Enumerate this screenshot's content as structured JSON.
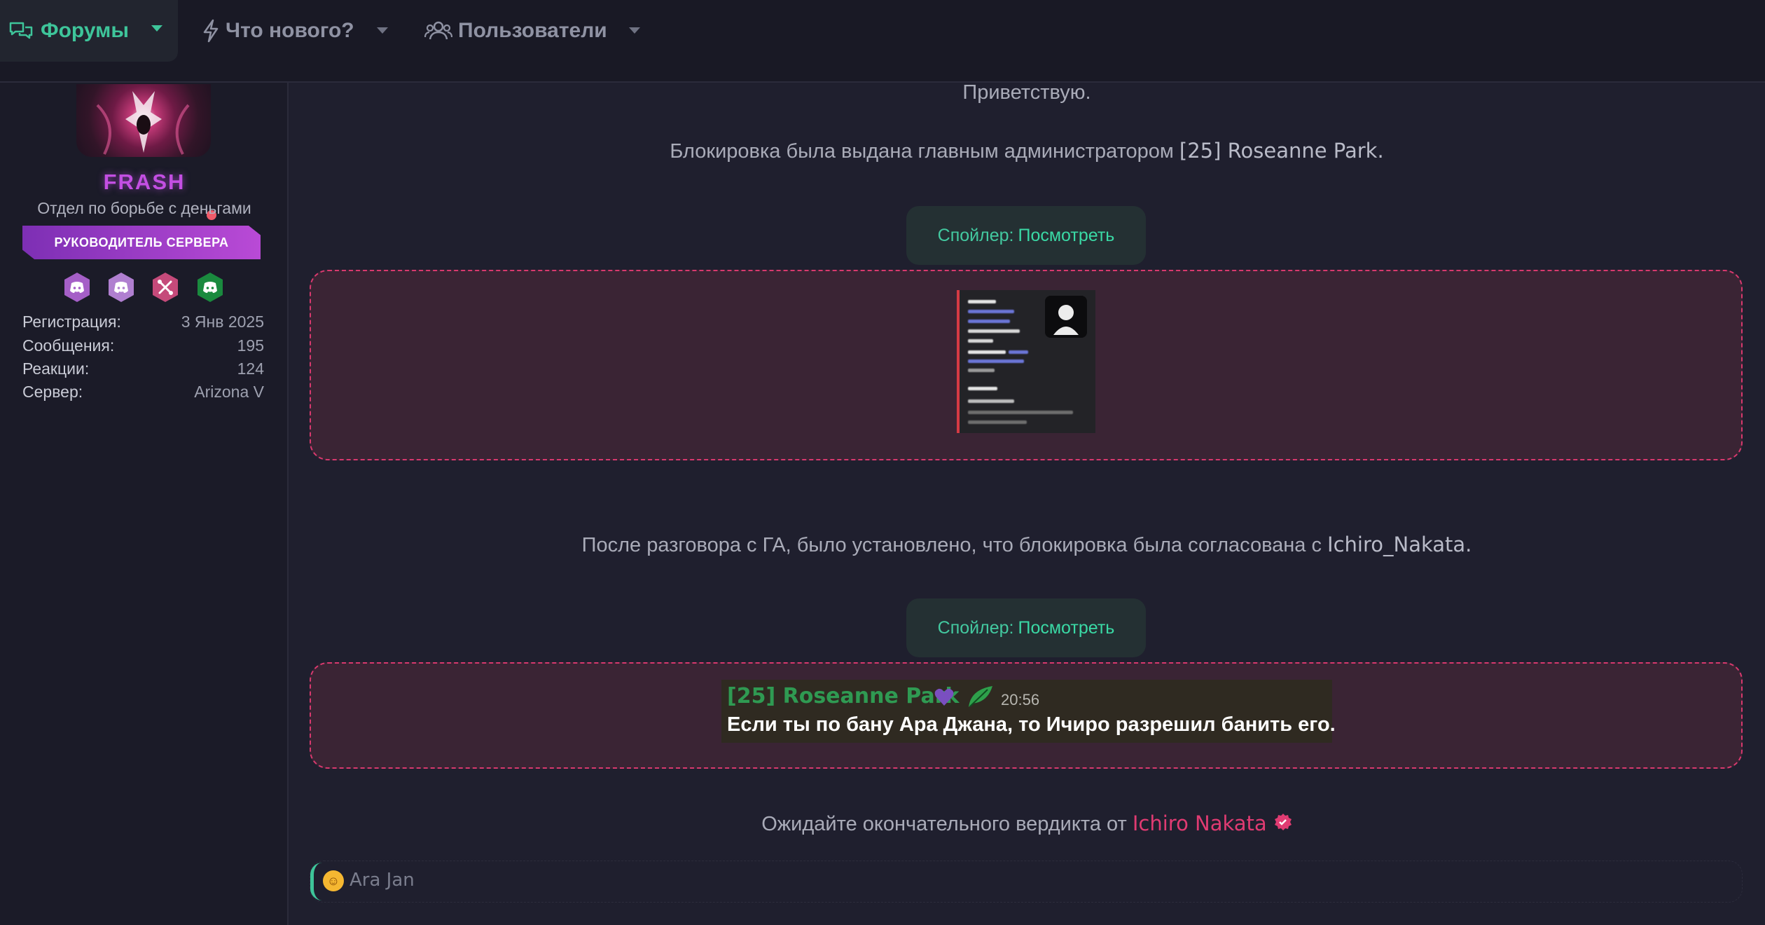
{
  "nav": {
    "tabs": [
      {
        "label": "Форумы",
        "icon": "chat-bubbles-icon",
        "active": true
      },
      {
        "label": "Что нового?",
        "icon": "lightning-icon",
        "active": false
      },
      {
        "label": "Пользователи",
        "icon": "users-icon",
        "active": false
      }
    ],
    "accent_color": "#3ec59a"
  },
  "user": {
    "name": "FRASH",
    "title": "Отдел по борьбе с деньгами",
    "role_badge": "РУКОВОДИТЕЛЬ СЕРВЕРА",
    "badges": [
      {
        "icon": "discord-icon",
        "color": "#a55fc7"
      },
      {
        "icon": "discord-icon",
        "color": "#b07fd0"
      },
      {
        "icon": "tools-icon",
        "color": "#c54a7a"
      },
      {
        "icon": "discord-icon",
        "color": "#1a8a3e"
      }
    ],
    "stats": [
      {
        "label": "Регистрация:",
        "value": "3 Янв 2025"
      },
      {
        "label": "Сообщения:",
        "value": "195"
      },
      {
        "label": "Реакции:",
        "value": "124"
      },
      {
        "label": "Сервер:",
        "value": "Arizona V"
      }
    ]
  },
  "post": {
    "greeting": "Приветствую.",
    "line1_prefix": "Блокировка была выдана главным администратором ",
    "line1_name": "[25] Roseanne Park.",
    "spoiler1": {
      "label": "Спойлер:",
      "action": "Посмотреть"
    },
    "line2_prefix": "После разговора с ГА, было установлено, что блокировка была согласована с ",
    "line2_name": "Ichiro_Nakata.",
    "spoiler2": {
      "label": "Спойлер:",
      "action": "Посмотреть"
    },
    "chat": {
      "author": "[25] Roseanne Park",
      "time": "20:56",
      "message": "Если ты по бану Ара Джана, то Ичиро разрешил банить его."
    },
    "verdict_prefix": "Ожидайте окончательного вердикта от ",
    "verdict_name": "Ichiro Nakata"
  },
  "reactions": {
    "emoji": "rofl-emoji-icon",
    "user": "Ara Jan"
  }
}
